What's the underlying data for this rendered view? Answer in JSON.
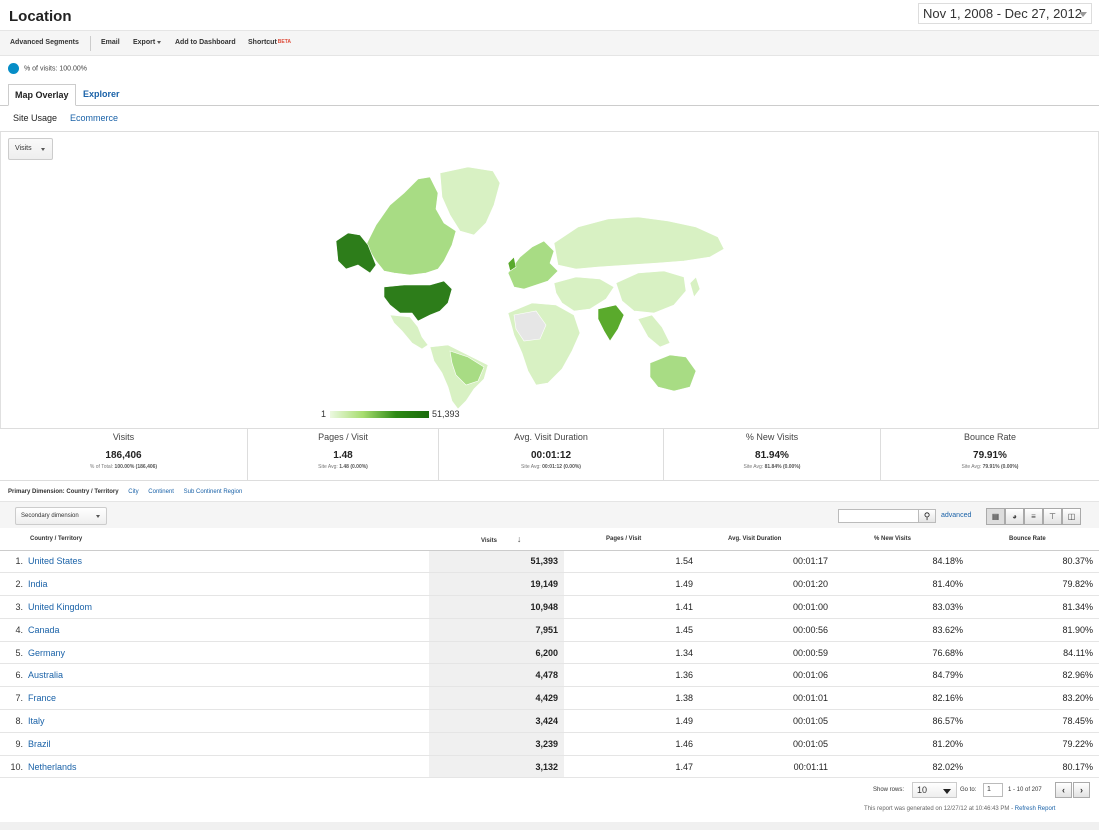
{
  "header": {
    "title": "Location",
    "date_range": "Nov 1, 2008 - Dec 27, 2012"
  },
  "toolbar": {
    "advanced_segments": "Advanced Segments",
    "email": "Email",
    "export": "Export",
    "add_to_dashboard": "Add to Dashboard",
    "shortcut": "Shortcut",
    "beta": "BETA"
  },
  "segment": {
    "label": "% of visits: 100.00%"
  },
  "tabs": {
    "map_overlay": "Map Overlay",
    "explorer": "Explorer"
  },
  "subtabs": {
    "site_usage": "Site Usage",
    "ecommerce": "Ecommerce"
  },
  "map": {
    "metric_select": "Visits",
    "legend_min": "1",
    "legend_max": "51,393",
    "colors": {
      "top": "#2d7d1a",
      "high": "#5aaa2c",
      "mid": "#a8dc84",
      "low": "#d8f1c3",
      "none": "#e6e6e6"
    }
  },
  "summary": [
    {
      "label": "Visits",
      "value": "186,406",
      "sub_prefix": "% of Total: ",
      "sub_bold": "100.00% (186,406)"
    },
    {
      "label": "Pages / Visit",
      "value": "1.48",
      "sub_prefix": "Site Avg: ",
      "sub_bold": "1.48 (0.00%)"
    },
    {
      "label": "Avg. Visit Duration",
      "value": "00:01:12",
      "sub_prefix": "Site Avg: ",
      "sub_bold": "00:01:12 (0.00%)"
    },
    {
      "label": "% New Visits",
      "value": "81.94%",
      "sub_prefix": "Site Avg: ",
      "sub_bold": "81.84% (0.00%)"
    },
    {
      "label": "Bounce Rate",
      "value": "79.91%",
      "sub_prefix": "Site Avg: ",
      "sub_bold": "79.91% (0.00%)"
    }
  ],
  "dimensions": {
    "label": "Primary Dimension:",
    "current": "Country / Territory",
    "city": "City",
    "continent": "Continent",
    "sub_continent": "Sub Continent Region"
  },
  "controls": {
    "secondary_dimension": "Secondary dimension",
    "advanced": "advanced"
  },
  "table": {
    "headers": [
      "Country / Territory",
      "Visits",
      "Pages / Visit",
      "Avg. Visit Duration",
      "% New Visits",
      "Bounce Rate"
    ],
    "rows": [
      {
        "idx": "1.",
        "country": "United States",
        "visits": "51,393",
        "ppv": "1.54",
        "dur": "00:01:17",
        "newv": "84.18%",
        "bounce": "80.37%"
      },
      {
        "idx": "2.",
        "country": "India",
        "visits": "19,149",
        "ppv": "1.49",
        "dur": "00:01:20",
        "newv": "81.40%",
        "bounce": "79.82%"
      },
      {
        "idx": "3.",
        "country": "United Kingdom",
        "visits": "10,948",
        "ppv": "1.41",
        "dur": "00:01:00",
        "newv": "83.03%",
        "bounce": "81.34%"
      },
      {
        "idx": "4.",
        "country": "Canada",
        "visits": "7,951",
        "ppv": "1.45",
        "dur": "00:00:56",
        "newv": "83.62%",
        "bounce": "81.90%"
      },
      {
        "idx": "5.",
        "country": "Germany",
        "visits": "6,200",
        "ppv": "1.34",
        "dur": "00:00:59",
        "newv": "76.68%",
        "bounce": "84.11%"
      },
      {
        "idx": "6.",
        "country": "Australia",
        "visits": "4,478",
        "ppv": "1.36",
        "dur": "00:01:06",
        "newv": "84.79%",
        "bounce": "82.96%"
      },
      {
        "idx": "7.",
        "country": "France",
        "visits": "4,429",
        "ppv": "1.38",
        "dur": "00:01:01",
        "newv": "82.16%",
        "bounce": "83.20%"
      },
      {
        "idx": "8.",
        "country": "Italy",
        "visits": "3,424",
        "ppv": "1.49",
        "dur": "00:01:05",
        "newv": "86.57%",
        "bounce": "78.45%"
      },
      {
        "idx": "9.",
        "country": "Brazil",
        "visits": "3,239",
        "ppv": "1.46",
        "dur": "00:01:05",
        "newv": "81.20%",
        "bounce": "79.22%"
      },
      {
        "idx": "10.",
        "country": "Netherlands",
        "visits": "3,132",
        "ppv": "1.47",
        "dur": "00:01:11",
        "newv": "82.02%",
        "bounce": "80.17%"
      }
    ]
  },
  "pager": {
    "show_rows": "Show rows:",
    "rows_value": "10",
    "goto": "Go to:",
    "goto_value": "1",
    "range": "1 - 10 of 207"
  },
  "footer": {
    "generated": "This report was generated on 12/27/12 at 10:46:43 PM -",
    "refresh": "Refresh Report"
  }
}
